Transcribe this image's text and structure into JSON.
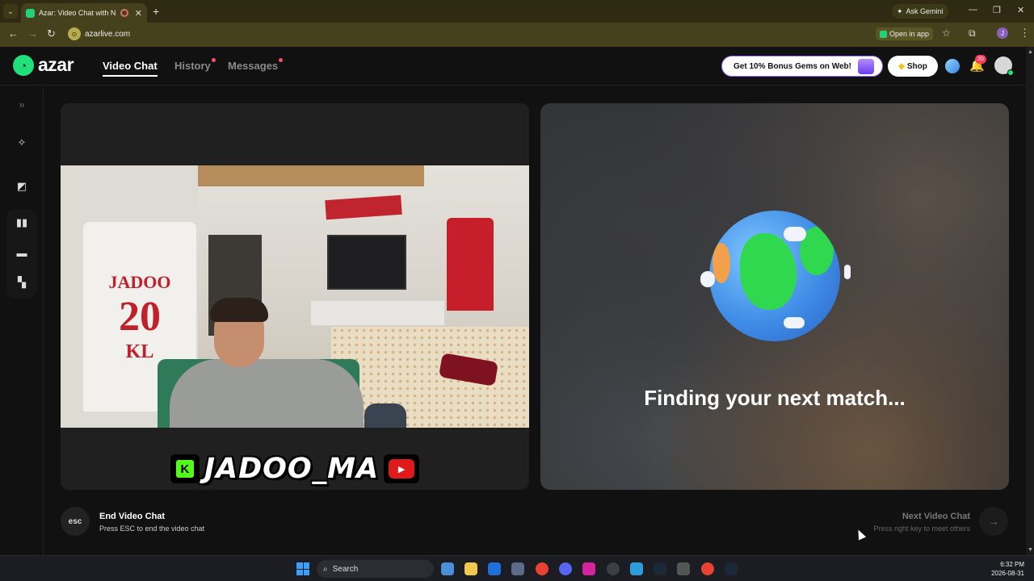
{
  "browser": {
    "tab_title": "Azar: Video Chat with New",
    "new_tab_symbol": "+",
    "ask_gemini": "Ask Gemini",
    "url": "azarlive.com",
    "open_in_app": "Open in app",
    "profile_initial": "J"
  },
  "header": {
    "logo_text": "azar",
    "nav": [
      {
        "label": "Video Chat",
        "active": true
      },
      {
        "label": "History",
        "dot": true
      },
      {
        "label": "Messages",
        "dot": true
      }
    ],
    "bonus_label": "Get 10% Bonus Gems on Web!",
    "shop_label": "Shop",
    "notification_count": "20"
  },
  "left_panel": {
    "jersey_name": "JADOO",
    "jersey_number": "20",
    "jersey_bottom": "KL",
    "username": "JADOO_MA"
  },
  "right_panel": {
    "status": "Finding your next match..."
  },
  "footer": {
    "esc_label": "esc",
    "end_title": "End Video Chat",
    "end_sub": "Press ESC to end the video chat",
    "next_title": "Next Video Chat",
    "next_sub": "Press right key to meet others"
  },
  "taskbar": {
    "search_label": "Search",
    "time": "6:32 PM",
    "date": "2026-08-31"
  },
  "colors": {
    "brand_green": "#1fe07b",
    "browser_frame": "#45411c",
    "notification_red": "#ff3b5c"
  }
}
